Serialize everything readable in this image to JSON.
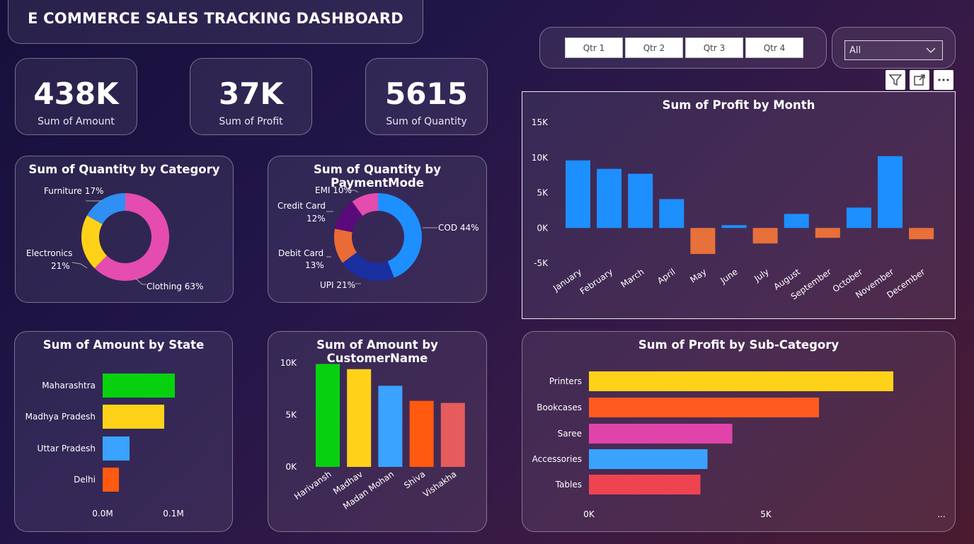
{
  "title": "E COMMERCE SALES TRACKING DASHBOARD",
  "kpis": [
    {
      "value": "438K",
      "label": "Sum of Amount"
    },
    {
      "value": "37K",
      "label": "Sum of Profit"
    },
    {
      "value": "5615",
      "label": "Sum of Quantity"
    }
  ],
  "quarters": [
    "Qtr 1",
    "Qtr 2",
    "Qtr 3",
    "Qtr 4"
  ],
  "filter": {
    "value": "All"
  },
  "colors": {
    "blue": "#1e8fff",
    "orange": "#e8703a"
  },
  "category_chart": {
    "title": "Sum of Quantity by Category",
    "type": "donut",
    "slices": [
      {
        "name": "Clothing",
        "value": 63,
        "label": "Clothing 63%",
        "color": "#e44cb0"
      },
      {
        "name": "Electronics",
        "value": 21,
        "label_1": "Electronics",
        "label_2": "21%",
        "color": "#ffd21a"
      },
      {
        "name": "Furniture",
        "value": 17,
        "label": "Furniture 17%",
        "color": "#2f8ff2"
      }
    ]
  },
  "payment_chart": {
    "title": "Sum of Quantity by PaymentMode",
    "type": "donut",
    "slices": [
      {
        "name": "COD",
        "value": 44,
        "label": "COD 44%",
        "color": "#1e8fff"
      },
      {
        "name": "UPI",
        "value": 21,
        "label": "UPI 21%",
        "color": "#1a2fa0"
      },
      {
        "name": "Debit Card",
        "value": 13,
        "label_1": "Debit Card",
        "label_2": "13%",
        "color": "#ea6b35"
      },
      {
        "name": "Credit Card",
        "value": 12,
        "label_1": "Credit Card",
        "label_2": "12%",
        "color": "#5a0a7a"
      },
      {
        "name": "EMI",
        "value": 10,
        "label": "EMI 10%",
        "color": "#e44cb0"
      }
    ]
  },
  "state_chart": {
    "title": "Sum of Amount by State",
    "type": "bar",
    "categories": [
      "Maharashtra",
      "Madhya Pradesh",
      "Uttar Pradesh",
      "Delhi"
    ],
    "values": [
      0.102,
      0.087,
      0.038,
      0.023
    ],
    "colors": [
      "#07d10f",
      "#ffd21a",
      "#3aa2ff",
      "#ff5a0f"
    ],
    "x_ticks": [
      "0.0M",
      "0.1M"
    ],
    "xlim": [
      0,
      0.1
    ]
  },
  "customer_chart": {
    "title": "Sum of Amount by CustomerName",
    "type": "bar",
    "categories": [
      "Harivansh",
      "Madhav",
      "Madan Mohan",
      "Shiva",
      "Vishakha"
    ],
    "values": [
      9900,
      9400,
      7800,
      6350,
      6150
    ],
    "colors": [
      "#07d10f",
      "#ffd21a",
      "#3aa2ff",
      "#ff5a0f",
      "#e65c5c"
    ],
    "y_ticks": [
      "10K",
      "5K",
      "0K"
    ],
    "ylim": [
      0,
      10000
    ]
  },
  "month_chart": {
    "title": "Sum of Profit by Month",
    "type": "bar",
    "categories": [
      "January",
      "February",
      "March",
      "April",
      "May",
      "June",
      "July",
      "August",
      "September",
      "October",
      "November",
      "December"
    ],
    "values": [
      9600,
      8400,
      7700,
      4100,
      -3700,
      400,
      -2200,
      2000,
      -1400,
      2900,
      10200,
      -1600
    ],
    "y_ticks": [
      "15K",
      "10K",
      "5K",
      "0K",
      "-5K"
    ],
    "ylim": [
      -5000,
      15000
    ]
  },
  "subcat_chart": {
    "title": "Sum of Profit by Sub-Category",
    "type": "bar",
    "categories": [
      "Printers",
      "Bookcases",
      "Saree",
      "Accessories",
      "Tables"
    ],
    "values": [
      8600,
      6500,
      4050,
      3350,
      3150
    ],
    "colors": [
      "#ffd21a",
      "#ff5a1f",
      "#e044ab",
      "#3aa2ff",
      "#ee4452"
    ],
    "x_ticks": [
      "0K",
      "5K"
    ],
    "xlim": [
      0,
      5000
    ],
    "more_label": "..."
  }
}
